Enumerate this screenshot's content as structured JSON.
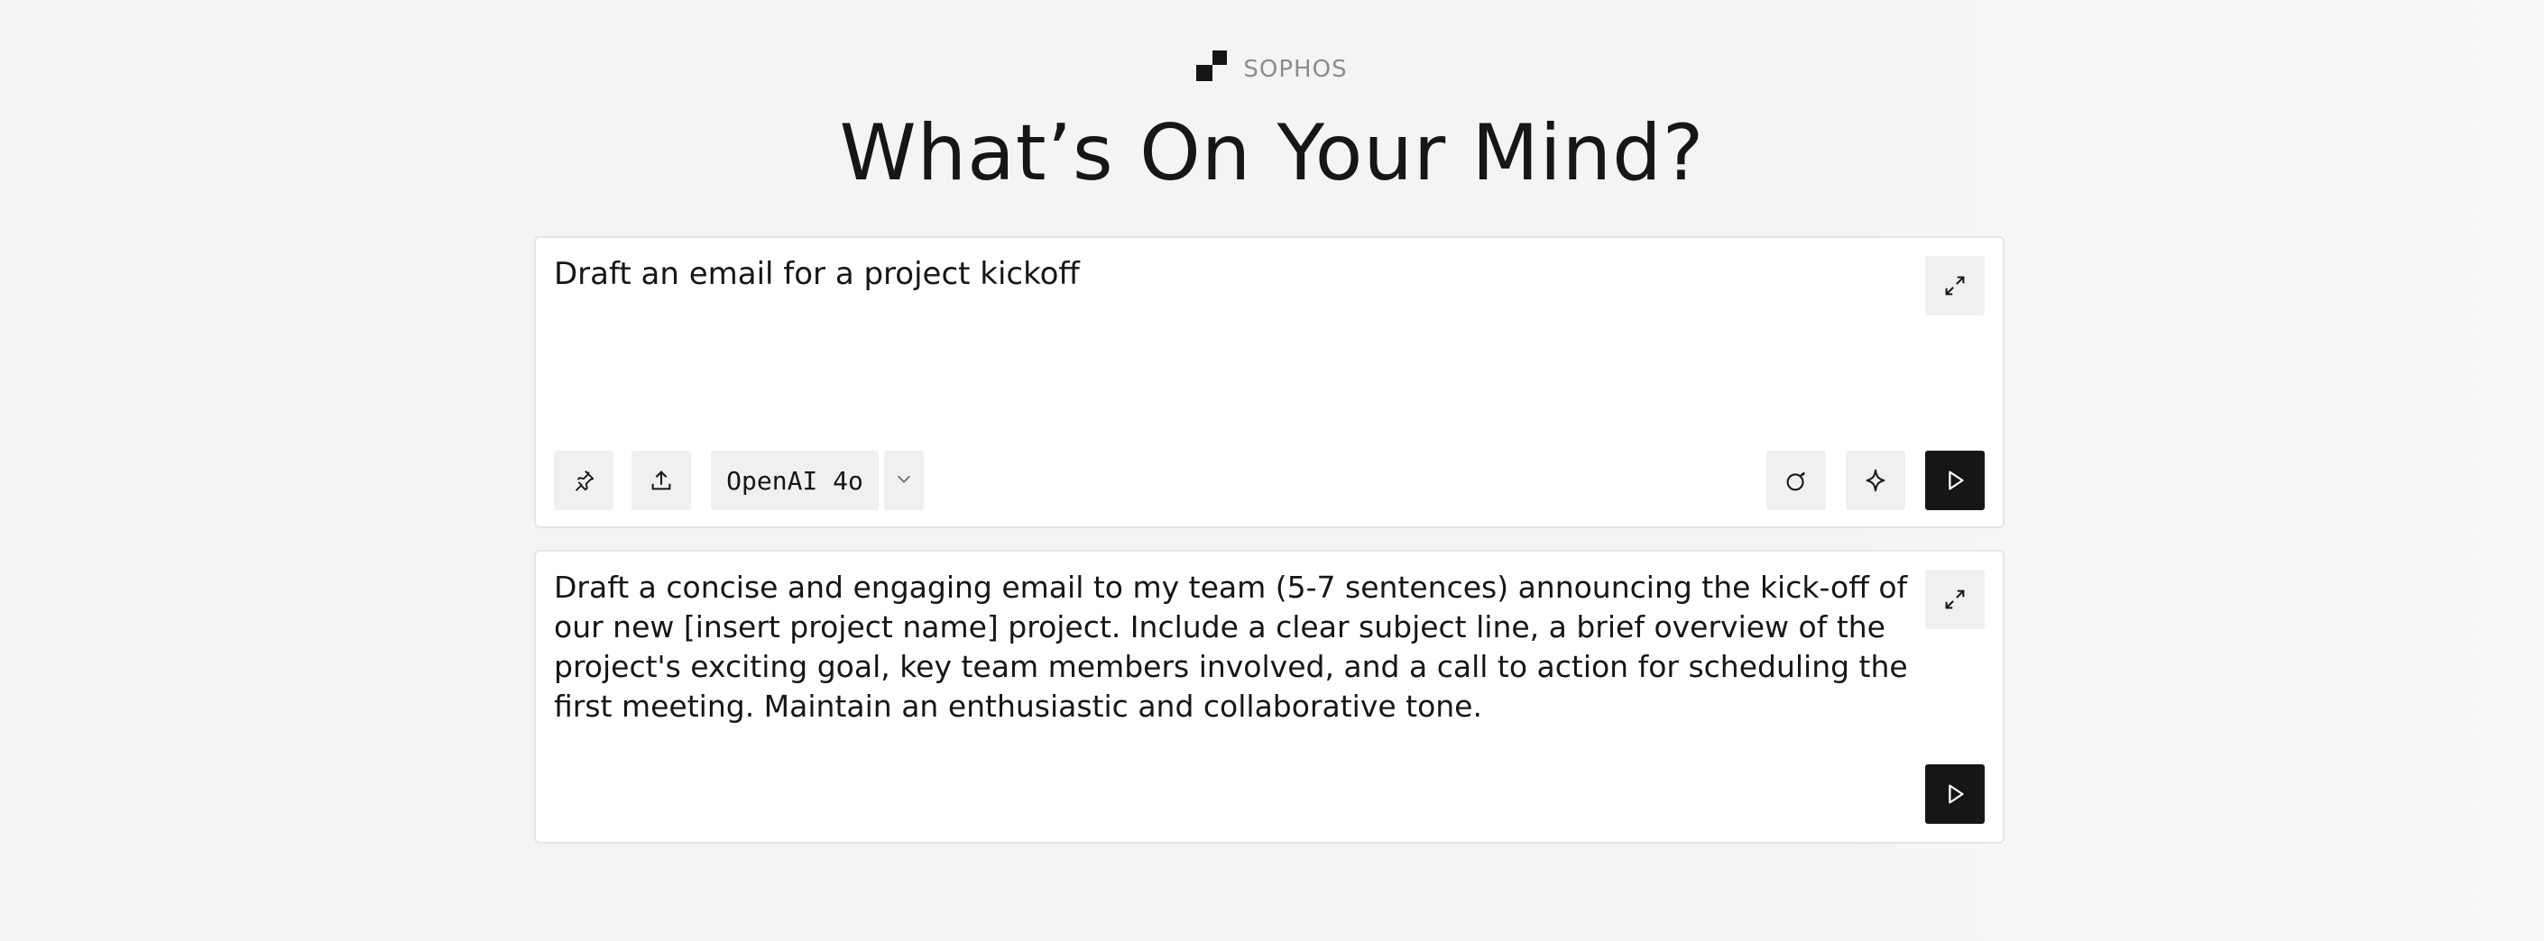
{
  "brand": {
    "name": "SOPHOS",
    "logo_icon": "sophos-logo-icon"
  },
  "page": {
    "title": "What’s On Your Mind?"
  },
  "prompt_card": {
    "text": "Draft an email for a project kickoff",
    "expand_icon": "expand-icon",
    "toolbar": {
      "pin_icon": "pin-icon",
      "upload_icon": "upload-icon",
      "model_label": "OpenAI 4o",
      "dropdown_icon": "chevron-down-icon",
      "bomb_icon": "bomb-icon",
      "sparkle_icon": "sparkle-icon",
      "run_icon": "play-icon"
    }
  },
  "result_card": {
    "text": "Draft a concise and engaging email to my team (5-7 sentences) announcing the kick-off of our new [insert project name] project. Include a clear subject line, a brief overview of the project's exciting goal, key team members involved, and a call to action for scheduling the first meeting. Maintain an enthusiastic and collaborative tone.",
    "expand_icon": "expand-icon",
    "run_icon": "play-icon"
  },
  "colors": {
    "background": "#f4f4f4",
    "card": "#ffffff",
    "button_bg": "#f0f0f0",
    "primary_dark": "#161616",
    "brand_text": "#8d8d8d"
  }
}
